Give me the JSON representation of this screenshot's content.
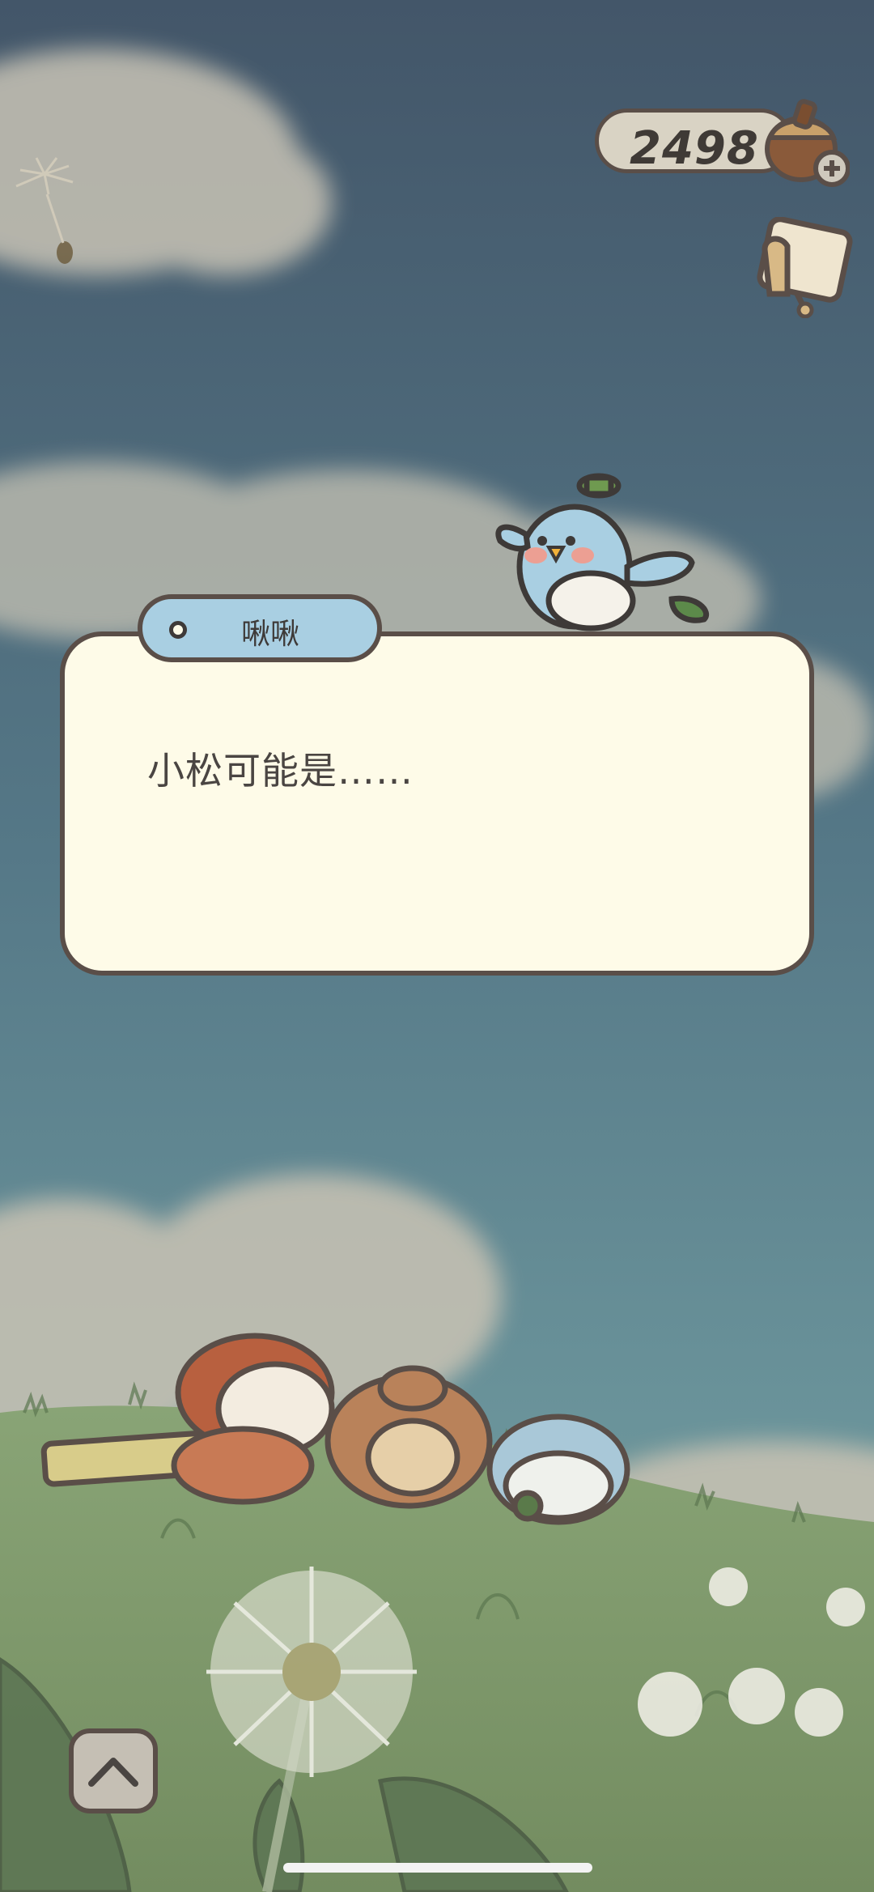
{
  "currency": {
    "value": "2498",
    "icon": "acorn-icon",
    "add_icon": "plus-icon"
  },
  "notes_button": {
    "icon": "notepad-icon"
  },
  "dialog": {
    "speaker": "啾啾",
    "text": "小松可能是……"
  },
  "expand_button": {
    "icon": "chevron-up-icon"
  },
  "colors": {
    "sky_top": "#445a70",
    "sky_bottom": "#6b9098",
    "grass": "#7f9a6a",
    "dialog_bg": "#fefbe8",
    "name_tag_bg": "#a9cfe2",
    "outline": "#5a4e48"
  }
}
